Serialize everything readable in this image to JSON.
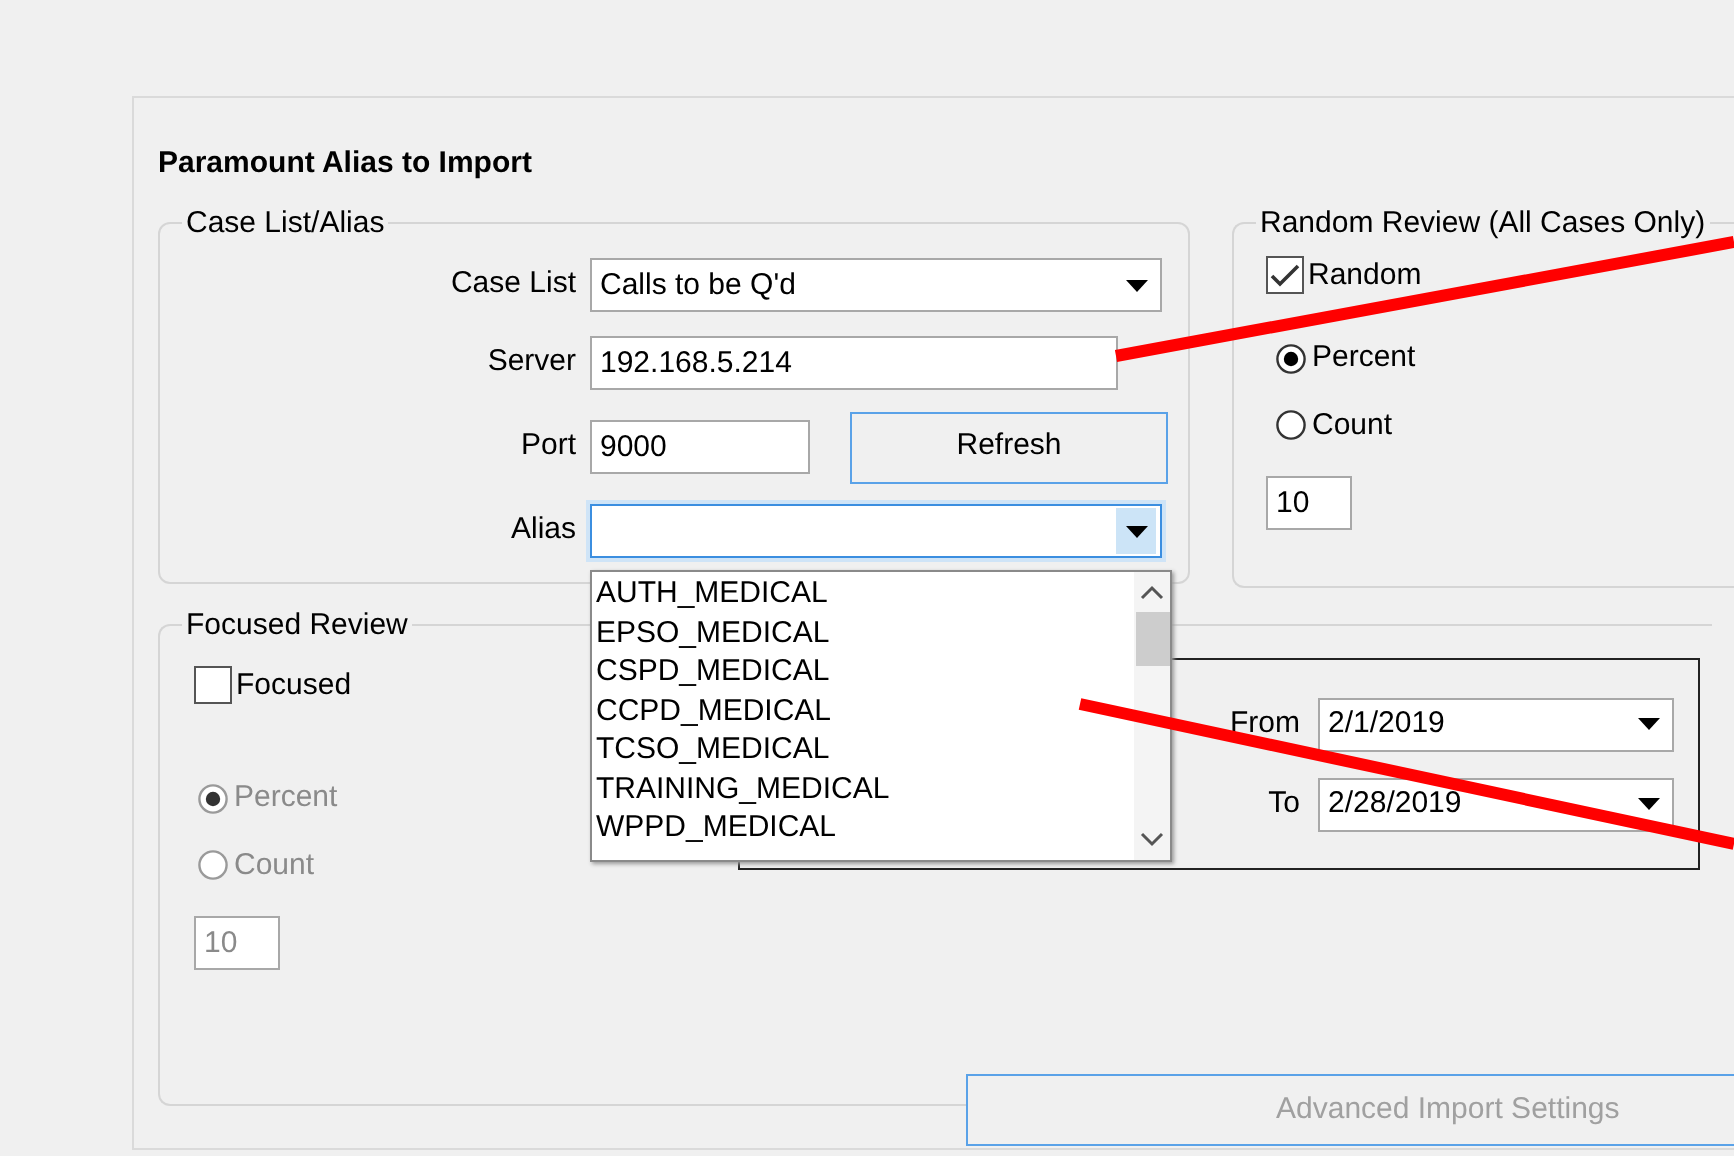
{
  "title": "Paramount Alias to Import",
  "case_list_alias": {
    "legend": "Case List/Alias",
    "fields": [
      {
        "label": "Case List",
        "kind": "dropdown",
        "value": "Calls to be Q'd",
        "focused": false
      },
      {
        "label": "Server",
        "kind": "text",
        "value": "192.168.5.214"
      },
      {
        "label": "Port",
        "kind": "text",
        "value": "9000",
        "button": "Refresh"
      },
      {
        "label": "Alias",
        "kind": "dropdown",
        "focused": true,
        "open": true
      }
    ],
    "alias_options": [
      "AUTH_MEDICAL",
      "EPSO_MEDICAL",
      "CSPD_MEDICAL",
      "CCPD_MEDICAL",
      "TCSO_MEDICAL",
      "TRAINING_MEDICAL",
      "WPPD_MEDICAL"
    ]
  },
  "random_review": {
    "legend": "Random Review (All Cases Only)",
    "checkbox": {
      "label": "Random",
      "checked": true
    },
    "options": [
      {
        "label": "Percent",
        "selected": true,
        "disabled": false
      },
      {
        "label": "Count",
        "selected": false,
        "disabled": false
      }
    ],
    "amount": {
      "value": "10",
      "disabled": false
    }
  },
  "focused_review": {
    "legend": "Focused Review",
    "checkbox": {
      "label": "Focused",
      "checked": false
    },
    "options": [
      {
        "label": "Percent",
        "selected": true,
        "disabled": true
      },
      {
        "label": "Count",
        "selected": false,
        "disabled": true
      }
    ],
    "amount": {
      "value": "10",
      "disabled": true
    },
    "date_range": [
      {
        "label": "From",
        "value": "2/1/2019"
      },
      {
        "label": "To",
        "value": "2/28/2019"
      }
    ],
    "advanced_button": {
      "label": "Advanced Import Settings",
      "disabled": true
    }
  }
}
